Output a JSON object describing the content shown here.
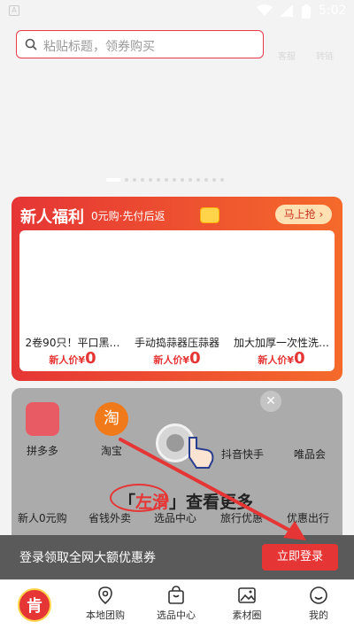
{
  "status": {
    "time": "5:02"
  },
  "search": {
    "placeholder": "粘贴标题，领券购买"
  },
  "top_links": [
    "客服",
    "转链"
  ],
  "newbie": {
    "title": "新人福利",
    "subtitle": "0元购·先付后返",
    "grab_label": "马上抢",
    "products": [
      {
        "name": "2卷90只！平口黑…",
        "price_label": "新人价¥",
        "price": "0"
      },
      {
        "name": "手动捣蒜器压蒜器",
        "price_label": "新人价¥",
        "price": "0"
      },
      {
        "name": "加大加厚一次性洗…",
        "price_label": "新人价¥",
        "price": "0"
      }
    ]
  },
  "platforms": [
    {
      "name": "拼多多",
      "icon": "pinduoduo-icon",
      "color": "#e85a64"
    },
    {
      "name": "淘宝",
      "icon": "taobao-icon",
      "color": "#f07a1a"
    },
    {
      "name": "抖音快手",
      "icon": "",
      "color": ""
    },
    {
      "name": "唯品会",
      "icon": "",
      "color": ""
    }
  ],
  "guide": {
    "open": "「",
    "highlight": "左滑",
    "close": "」",
    "rest": "查看更多"
  },
  "categories": [
    "新人0元购",
    "省钱外卖",
    "选品中心",
    "旅行优惠",
    "优惠出行"
  ],
  "login_bar": {
    "text": "登录领取全网大额优惠券",
    "button": "立即登录"
  },
  "tabbar": {
    "logo": "肯",
    "items": [
      {
        "label": "本地团购",
        "icon": "location-pin-icon"
      },
      {
        "label": "选品中心",
        "icon": "shopping-bag-icon"
      },
      {
        "label": "素材圈",
        "icon": "image-icon"
      },
      {
        "label": "我的",
        "icon": "smiley-icon"
      }
    ]
  },
  "colors": {
    "brand_red": "#e53535",
    "overlay_gray": "#ababab"
  }
}
